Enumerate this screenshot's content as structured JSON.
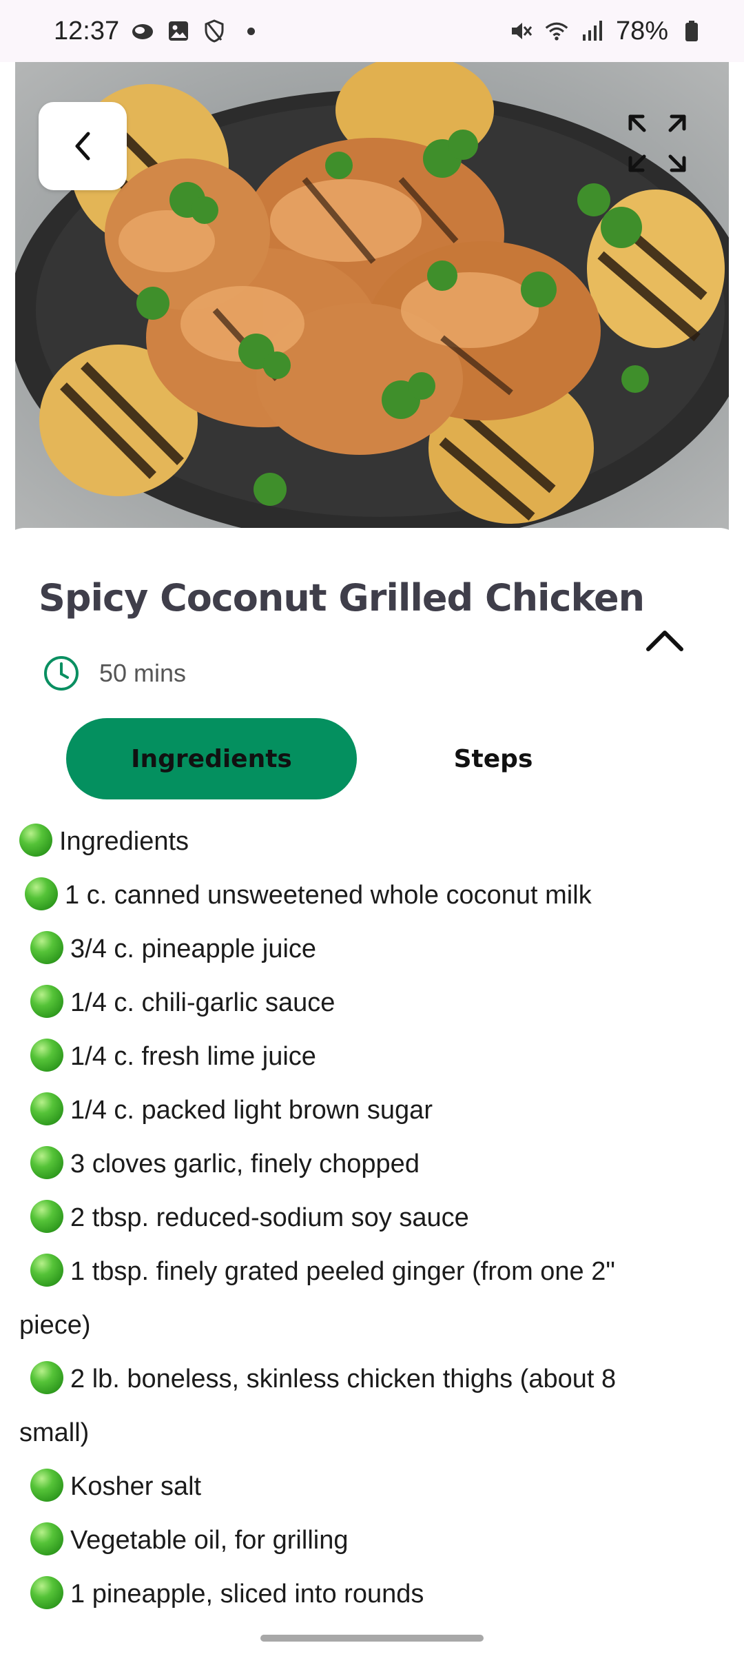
{
  "status_bar": {
    "time": "12:37",
    "battery": "78%",
    "icons": [
      "cloud-icon",
      "gallery-icon",
      "shield-icon",
      "dot-icon",
      "mute-icon",
      "wifi-icon",
      "signal-icon",
      "battery-icon"
    ]
  },
  "hero": {
    "image": "grilled-chicken-photo",
    "back_icon": "chevron-left-icon",
    "expand_icon": "fullscreen-icon"
  },
  "recipe": {
    "title": "Spicy Coconut Grilled Chicken",
    "time": "50 mins",
    "collapse_icon": "chevron-up-icon"
  },
  "tabs": {
    "ingredients": "Ingredients",
    "steps": "Steps",
    "active": "Ingredients",
    "accent_color": "#04905f"
  },
  "ingredients": [
    "Ingredients",
    "1 c. canned unsweetened whole coconut milk",
    "3/4 c. pineapple juice",
    "1/4 c. chili-garlic sauce",
    "1/4 c. fresh lime juice",
    "1/4 c. packed light brown sugar",
    "3 cloves garlic, finely chopped",
    "2 tbsp. reduced-sodium soy sauce",
    "1 tbsp. finely grated peeled ginger (from one 2\"",
    "piece)",
    "2 lb. boneless, skinless chicken thighs (about 8",
    "small)",
    "Kosher salt",
    "Vegetable oil, for grilling",
    "1 pineapple, sliced into rounds"
  ]
}
